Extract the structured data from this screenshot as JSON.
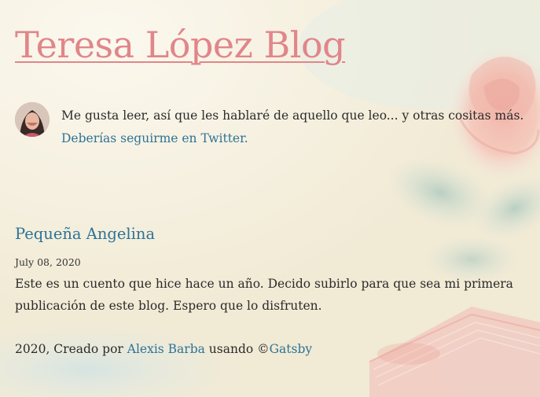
{
  "site": {
    "title": "Teresa López Blog"
  },
  "bio": {
    "text": "Me gusta leer, así que les hablaré de aquello que leo... y otras cositas más.",
    "twitter_link": "Deberías seguirme en Twitter."
  },
  "posts": [
    {
      "title": "Pequeña Angelina",
      "date": "July 08, 2020",
      "excerpt": "Este es un cuento que hice hace un año. Decido subirlo para que sea mi primera publicación de este blog. Espero que lo disfruten."
    }
  ],
  "footer": {
    "prefix": "2020, Creado por ",
    "author_link": "Alexis Barba",
    "middle": " usando ©",
    "gatsby_link": "Gatsby"
  },
  "colors": {
    "title": "#e0868a",
    "link": "#2d7395",
    "text": "#2b2b2b"
  }
}
